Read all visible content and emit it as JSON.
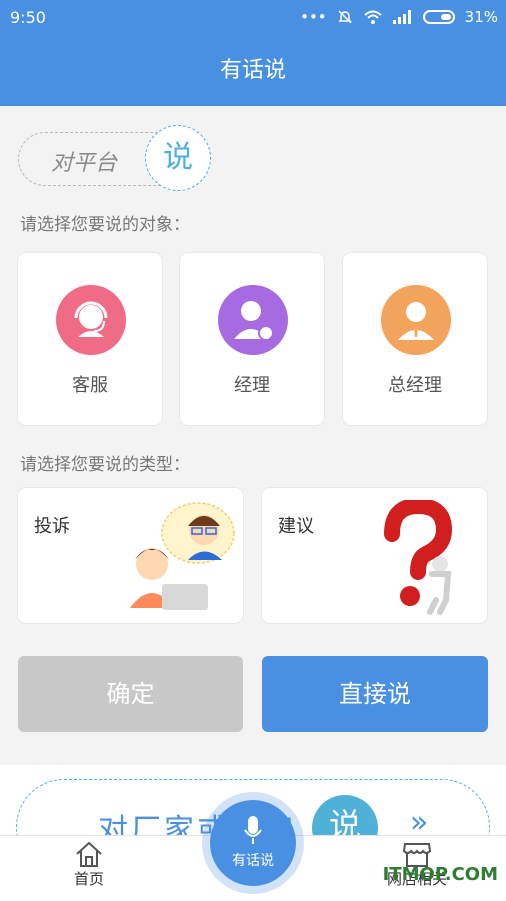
{
  "status": {
    "time": "9:50",
    "battery": "31%"
  },
  "header": {
    "title": "有话说"
  },
  "mode_pill": {
    "text": "对平台",
    "badge": "说"
  },
  "targets": {
    "prompt": "请选择您要说的对象：",
    "items": [
      {
        "label": "客服",
        "color": "#f06b86"
      },
      {
        "label": "经理",
        "color": "#a66be0"
      },
      {
        "label": "总经理",
        "color": "#f2a45c"
      }
    ]
  },
  "types": {
    "prompt": "请选择您要说的类型：",
    "items": [
      {
        "label": "投诉"
      },
      {
        "label": "建议"
      }
    ]
  },
  "actions": {
    "confirm_label": "确定",
    "confirm_color": "#c8c8c8",
    "direct_label": "直接说",
    "direct_color": "#4a90e2"
  },
  "banner": {
    "text": "对厂家或专家",
    "badge": "说",
    "arrow": "»"
  },
  "tabbar": {
    "home": "首页",
    "center": "有话说",
    "shop": "网店相关"
  },
  "watermark": "ITMOP.COM"
}
